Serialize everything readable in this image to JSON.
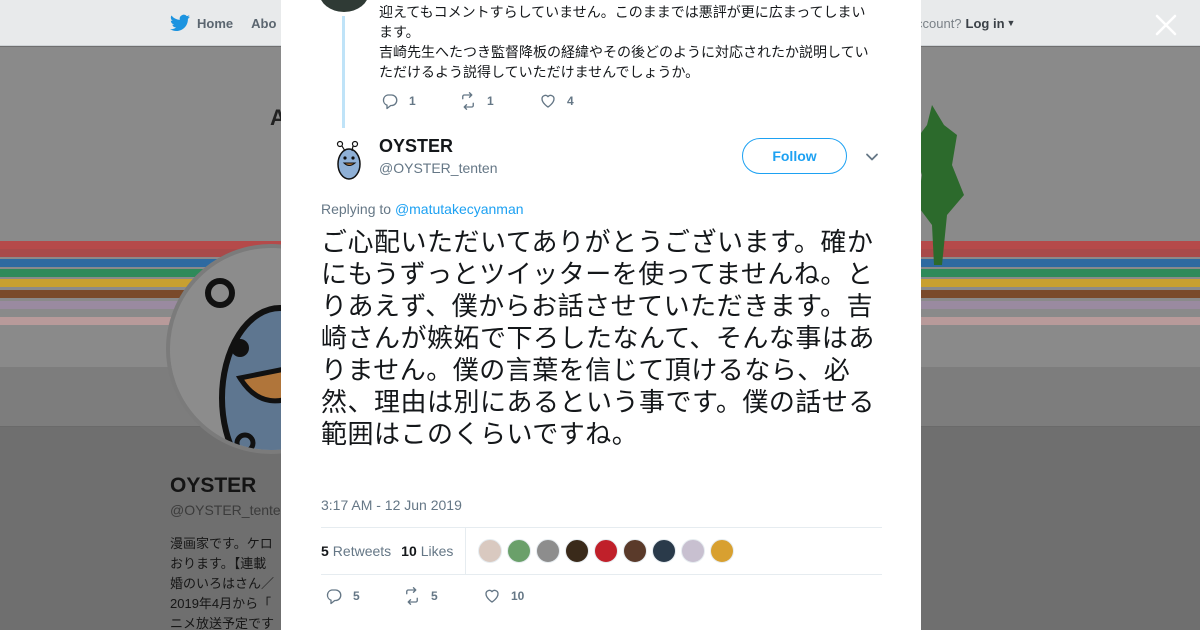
{
  "background": {
    "nav": {
      "home_label": "Home",
      "about_label": "Abo",
      "account_prompt": "ccount?",
      "login_label": "Log in"
    },
    "banner_text": "A",
    "profile": {
      "name": "OYSTER",
      "handle": "@OYSTER_tente",
      "bio": "漫画家です。ケロ\nおります。【連載\n婚のいろはさん／\n2019年4月から「\nニメ放送予定です"
    }
  },
  "previous_tweet": {
    "text": "迎えてもコメントすらしていません。このままでは悪評が更に広まってしまいます。\n吉崎先生へたつき監督降板の経緯やその後どのように対応されたか説明していただけるよう説得していただけませんでしょうか。",
    "replies": "1",
    "retweets": "1",
    "likes": "4"
  },
  "tweet": {
    "author_name": "OYSTER",
    "author_handle": "@OYSTER_tenten",
    "follow_label": "Follow",
    "replying_prefix": "Replying to",
    "replying_to": "@matutakecyanman",
    "text": "ご心配いただいてありがとうございます。確かにもうずっとツイッターを使ってませんね。とりあえず、僕からお話させていただきます。吉崎さんが嫉妬で下ろしたなんて、そんな事はありません。僕の言葉を信じて頂けるなら、必然、理由は別にあるという事です。僕の話せる範囲はこのくらいですね。",
    "timestamp": "3:17 AM - 12 Jun 2019",
    "retweets_count": "5",
    "retweets_label": "Retweets",
    "likes_count": "10",
    "likes_label": "Likes",
    "liker_colors": [
      "#d9c9c0",
      "#6aa06a",
      "#8d8d8d",
      "#3a2a1a",
      "#c0202a",
      "#5a3a2a",
      "#2a3a4a",
      "#c8c0d0",
      "#d8a030"
    ],
    "actions": {
      "replies": "5",
      "retweets": "5",
      "likes": "10"
    }
  },
  "colors": {
    "accent": "#1da1f2",
    "muted": "#657786",
    "thread_line": "#bfe3f8"
  },
  "icons": [
    "twitter-bird-icon",
    "close-icon",
    "reply-icon",
    "retweet-icon",
    "heart-icon",
    "chevron-down-icon"
  ]
}
